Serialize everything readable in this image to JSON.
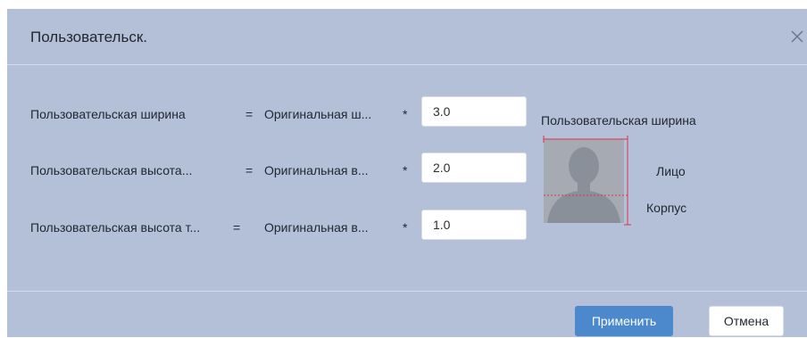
{
  "dialog": {
    "title": "Пользовательск.",
    "close_icon": "close-icon"
  },
  "rows": [
    {
      "label": "Пользовательская ширина",
      "equals": "=",
      "original": "Оригинальная ш...",
      "star": "*",
      "value": "3.0"
    },
    {
      "label": "Пользовательская высота...",
      "equals": "=",
      "original": "Оригинальная в...",
      "star": "*",
      "value": "2.0"
    },
    {
      "label": "Пользовательская высота т...",
      "equals": "=",
      "original": "Оригинальная в...",
      "star": "*",
      "value": "1.0"
    }
  ],
  "preview": {
    "title": "Пользовательская ширина",
    "face_label": "Лицо",
    "body_label": "Корпус",
    "guide_color": "#e0304a"
  },
  "footer": {
    "apply_label": "Применить",
    "cancel_label": "Отмена"
  }
}
